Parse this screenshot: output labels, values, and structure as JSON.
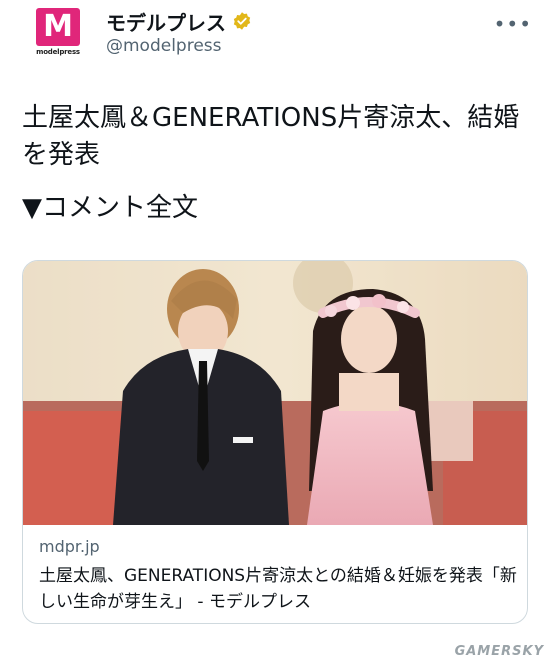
{
  "header": {
    "avatar_text": "M",
    "avatar_label": "modelpress",
    "display_name": "モデルプレス",
    "handle": "@modelpress",
    "more_label": "•••"
  },
  "tweet": {
    "line1": "土屋太鳳＆GENERATIONS片寄涼太、結婚を発表",
    "line2": "▼コメント全文"
  },
  "card": {
    "domain": "mdpr.jp",
    "title": "土屋太鳳、GENERATIONS片寄涼太との結婚＆妊娠を発表「新しい生命が芽生え」 - モデルプレス"
  },
  "watermark": "GAMERSKY",
  "colors": {
    "brand_pink": "#e0267a",
    "verified_gold": "#e2b719",
    "secondary_text": "#536471",
    "border": "#cfd9de"
  }
}
